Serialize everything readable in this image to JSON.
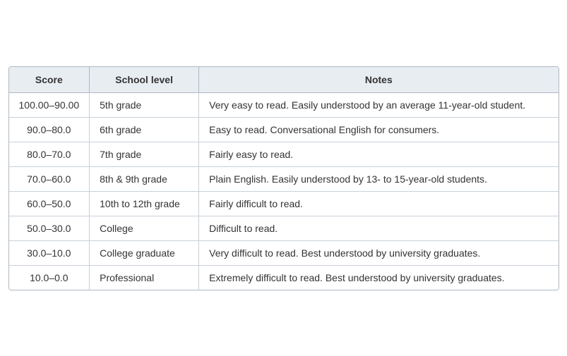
{
  "table": {
    "headers": {
      "score": "Score",
      "school_level": "School level",
      "notes": "Notes"
    },
    "rows": [
      {
        "score": "100.00–90.00",
        "school_level": "5th grade",
        "notes": "Very easy to read. Easily understood by an average 11-year-old student."
      },
      {
        "score": "90.0–80.0",
        "school_level": "6th grade",
        "notes": "Easy to read. Conversational English for consumers."
      },
      {
        "score": "80.0–70.0",
        "school_level": "7th grade",
        "notes": "Fairly easy to read."
      },
      {
        "score": "70.0–60.0",
        "school_level": "8th & 9th grade",
        "notes": "Plain English. Easily understood by 13- to 15-year-old students."
      },
      {
        "score": "60.0–50.0",
        "school_level": "10th to 12th grade",
        "notes": "Fairly difficult to read."
      },
      {
        "score": "50.0–30.0",
        "school_level": "College",
        "notes": "Difficult to read."
      },
      {
        "score": "30.0–10.0",
        "school_level": "College graduate",
        "notes": "Very difficult to read. Best understood by university graduates."
      },
      {
        "score": "10.0–0.0",
        "school_level": "Professional",
        "notes": "Extremely difficult to read. Best understood by university graduates."
      }
    ]
  }
}
